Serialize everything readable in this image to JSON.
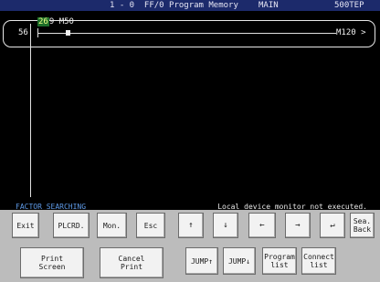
{
  "header": {
    "title": "1 - 0  FF/0 Program Memory",
    "program": "MAIN",
    "step_count": "500TEP"
  },
  "ladder": {
    "step_number": "56",
    "contact_device": "M50",
    "contact_value": "26",
    "contact_value_b": "9",
    "coil_label": "M120 >"
  },
  "status": {
    "mode": "FACTOR SEARCHING",
    "message": "Local device monitor not executed."
  },
  "buttons_row1": [
    {
      "label": "Exit"
    },
    {
      "label": "PLCRD."
    },
    {
      "label": "Mon."
    },
    {
      "label": "Esc"
    },
    {
      "label": "↑"
    },
    {
      "label": "↓"
    },
    {
      "label": "←"
    },
    {
      "label": "→"
    },
    {
      "label": "↵"
    },
    {
      "label": "Sea.\nBack"
    }
  ],
  "buttons_row2": [
    {
      "label": "Print\nScreen"
    },
    {
      "label": "Cancel\nPrint"
    },
    {
      "label": "JUMP↑"
    },
    {
      "label": "JUMP↓"
    },
    {
      "label": "Program\nlist"
    },
    {
      "label": "Connect\nlist"
    }
  ],
  "colors": {
    "header_bg": "#1c2a6b",
    "status_left": "#5f9be8",
    "highlight_value_bg": "#1d6e2a"
  }
}
